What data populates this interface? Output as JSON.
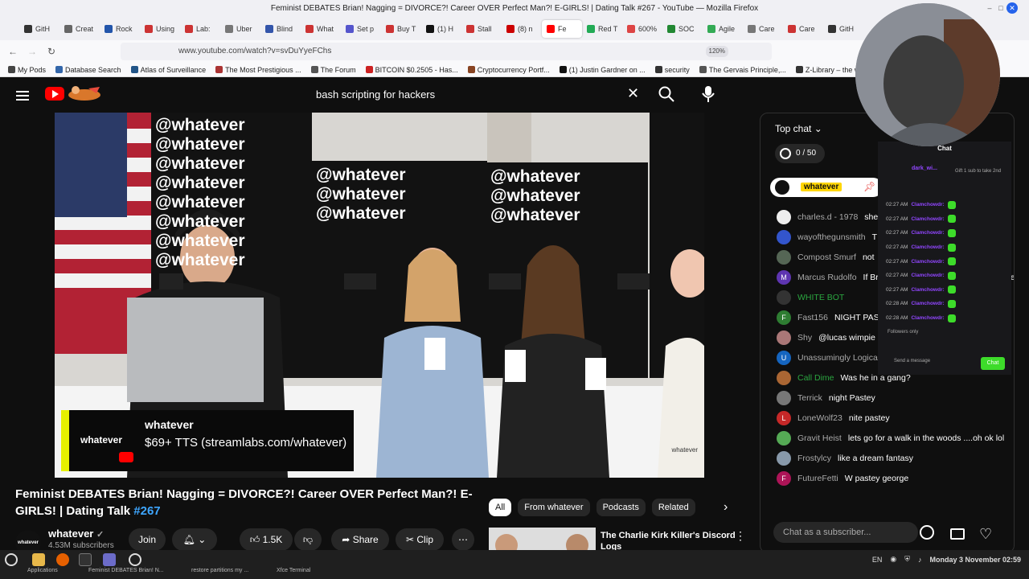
{
  "browser": {
    "window_title": "Feminist DEBATES Brian! Nagging = DIVORCE?! Career OVER Perfect Man?! E-GIRLS! | Dating Talk #267 - YouTube — Mozilla Firefox",
    "url": "www.youtube.com/watch?v=svDuYyeFChs",
    "zoom": "120%",
    "tabs": [
      {
        "label": "GitH",
        "color": "#333333"
      },
      {
        "label": "Creat",
        "color": "#666666"
      },
      {
        "label": "Rock",
        "color": "#2255aa"
      },
      {
        "label": "Using",
        "color": "#cc3333"
      },
      {
        "label": "Lab:",
        "color": "#cc3333"
      },
      {
        "label": "Uber",
        "color": "#777777"
      },
      {
        "label": "Blind",
        "color": "#3355aa"
      },
      {
        "label": "What",
        "color": "#cc3333"
      },
      {
        "label": "Set p",
        "color": "#5555cc"
      },
      {
        "label": "Buy T",
        "color": "#cc3333"
      },
      {
        "label": "(1) H",
        "color": "#111111"
      },
      {
        "label": "Stall",
        "color": "#cc3333"
      },
      {
        "label": "(8) n",
        "color": "#cc0000"
      },
      {
        "label": "Fe",
        "color": "#ff0000",
        "active": true
      },
      {
        "label": "Red T",
        "color": "#22aa55"
      },
      {
        "label": "600%",
        "color": "#dd4444"
      },
      {
        "label": "SOC",
        "color": "#228833"
      },
      {
        "label": "Agile",
        "color": "#33aa55"
      },
      {
        "label": "Care",
        "color": "#777777"
      },
      {
        "label": "Care",
        "color": "#cc3333"
      },
      {
        "label": "GitH",
        "color": "#333333"
      }
    ],
    "bookmarks": [
      {
        "label": "My Pods",
        "color": "#444444"
      },
      {
        "label": "Database Search",
        "color": "#3366aa"
      },
      {
        "label": "Atlas of Surveillance",
        "color": "#225588"
      },
      {
        "label": "The Most Prestigious ...",
        "color": "#aa3333"
      },
      {
        "label": "The Forum",
        "color": "#555555"
      },
      {
        "label": "BITCOIN $0.2505 - Has...",
        "color": "#cc2222"
      },
      {
        "label": "Cryptocurrency Portf...",
        "color": "#884422"
      },
      {
        "label": "(1) Justin Gardner on ...",
        "color": "#111111"
      },
      {
        "label": "security",
        "color": "#333333"
      },
      {
        "label": "The Gervais Principle,...",
        "color": "#555555"
      },
      {
        "label": "Z-Library – the world'...",
        "color": "#333333"
      }
    ]
  },
  "youtube": {
    "search_query": "bash scripting for hackers",
    "video_overlay": {
      "brand": "whatever",
      "title": "whatever",
      "line": "$69+ TTS (streamlabs.com/whatever)",
      "watermark": "whatever",
      "wall_text": "@whatever"
    },
    "video_title": "Feminist DEBATES Brian! Nagging = DIVORCE?! Career OVER Perfect Man?! E-GIRLS! | Dating Talk ",
    "video_tag": "#267",
    "channel": {
      "avatar_text": "whatever",
      "name": "whatever",
      "subscribers": "4.53M subscribers"
    },
    "buttons": {
      "join": "Join",
      "likes": "1.5K",
      "share": "Share",
      "clip": "Clip"
    },
    "filters": [
      "All",
      "From whatever",
      "Podcasts",
      "Related"
    ],
    "recommendation": {
      "title": "The Charlie Kirk Killer's Discord",
      "title_line2": "Logs"
    }
  },
  "chat": {
    "header": "Top chat",
    "goal": "0 / 50",
    "pinned_name": "whatever",
    "input_placeholder": "Chat as a subscriber...",
    "messages": [
      {
        "author": "charles.d - 1978",
        "text": "she",
        "avatar_color": "#eeeeee",
        "initial": ""
      },
      {
        "author": "wayofthegunsmith",
        "text": "T",
        "avatar_color": "#3355cc",
        "initial": ""
      },
      {
        "author": "Compost Smurf",
        "text": "not",
        "avatar_color": "#556655",
        "initial": ""
      },
      {
        "author": "Marcus Rudolfo",
        "text": "If Br have children, he sho Andrew made that cle",
        "avatar_color": "#5e35b1",
        "initial": "M"
      },
      {
        "author": "WHITE BOT",
        "text": "",
        "avatar_color": "#333333",
        "initial": "",
        "green": true
      },
      {
        "author": "Fast156",
        "text": "NIGHT PAS",
        "avatar_color": "#2e7d32",
        "initial": "F"
      },
      {
        "author": "Shy",
        "text": "@lucas wimpie",
        "avatar_color": "#aa7777",
        "initial": ""
      },
      {
        "author": "Unassumingly Logica",
        "text": "",
        "avatar_color": "#1565c0",
        "initial": "U"
      },
      {
        "author": "Call Dime",
        "text": "Was he in a gang?",
        "avatar_color": "#aa6633",
        "initial": "",
        "green": true
      },
      {
        "author": "Terrick",
        "text": "night Pastey",
        "avatar_color": "#777777",
        "initial": ""
      },
      {
        "author": "LoneWolf23",
        "text": "nite pastey",
        "avatar_color": "#c62828",
        "initial": "L"
      },
      {
        "author": "Gravit Heist",
        "text": "lets go for a walk in the woods ....oh ok lol",
        "avatar_color": "#55aa55",
        "initial": ""
      },
      {
        "author": "Frostylcy",
        "text": "like a dream fantasy",
        "avatar_color": "#8899aa",
        "initial": ""
      },
      {
        "author": "FutureFetti",
        "text": "W pastey george",
        "avatar_color": "#ad1457",
        "initial": "F"
      }
    ]
  },
  "twitch_overlay": {
    "header": "Chat",
    "gift_user": "dark_wi...",
    "gift_text": "Gift 1 sub to take 2nd",
    "rows": [
      {
        "time": "02:27 AM",
        "user": "Clamchowdr:"
      },
      {
        "time": "02:27 AM",
        "user": "Clamchowdr:"
      },
      {
        "time": "02:27 AM",
        "user": "Clamchowdr:"
      },
      {
        "time": "02:27 AM",
        "user": "Clamchowdr:"
      },
      {
        "time": "02:27 AM",
        "user": "Clamchowdr:"
      },
      {
        "time": "02:27 AM",
        "user": "Clamchowdr:"
      },
      {
        "time": "02:27 AM",
        "user": "Clamchowdr:"
      },
      {
        "time": "02:28 AM",
        "user": "Clamchowdr:"
      },
      {
        "time": "02:28 AM",
        "user": "Clamchowdr:"
      }
    ],
    "followers_only": "Followers only",
    "send_placeholder": "Send a message",
    "chat_button": "Chat"
  },
  "taskbar": {
    "items": [
      "Applications",
      "Feminist DEBATES Brian! N...",
      "restore partitions my ...",
      "Xfce Terminal"
    ],
    "lang": "EN",
    "clock": "Monday  3 November 02:59"
  }
}
